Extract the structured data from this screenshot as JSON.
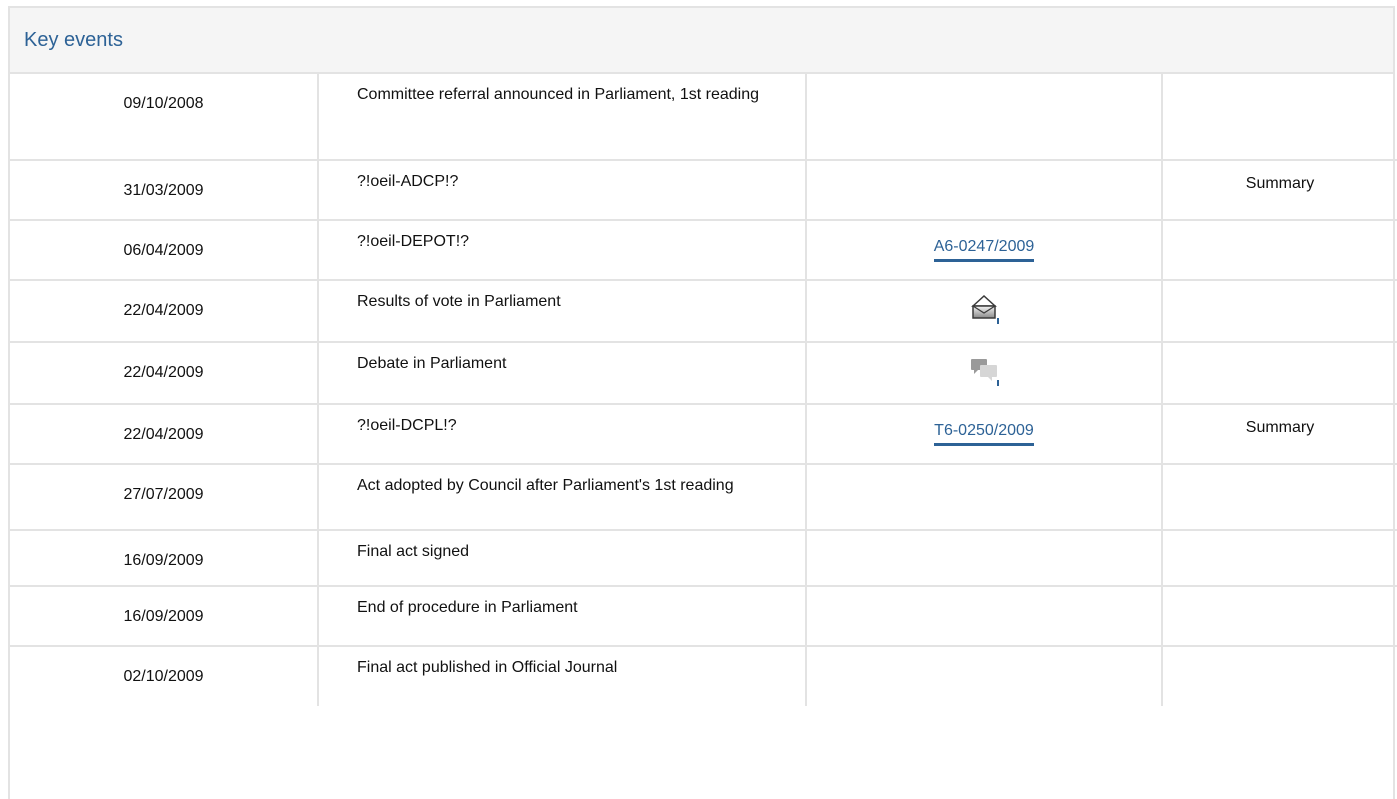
{
  "panel": {
    "title": "Key events"
  },
  "events": [
    {
      "date": "09/10/2008",
      "event": "Committee referral announced in Parliament, 1st reading",
      "doc": "",
      "doc_icon": "",
      "summary": ""
    },
    {
      "date": "31/03/2009",
      "event": "?!oeil-ADCP!?",
      "doc": "",
      "doc_icon": "",
      "summary": "Summary"
    },
    {
      "date": "06/04/2009",
      "event": "?!oeil-DEPOT!?",
      "doc": "A6-0247/2009",
      "doc_icon": "",
      "summary": ""
    },
    {
      "date": "22/04/2009",
      "event": "Results of vote in Parliament",
      "doc": "",
      "doc_icon": "vote-results-icon",
      "summary": ""
    },
    {
      "date": "22/04/2009",
      "event": "Debate in Parliament",
      "doc": "",
      "doc_icon": "debate-icon",
      "summary": ""
    },
    {
      "date": "22/04/2009",
      "event": "?!oeil-DCPL!?",
      "doc": "T6-0250/2009",
      "doc_icon": "",
      "summary": "Summary"
    },
    {
      "date": "27/07/2009",
      "event": "Act adopted by Council after Parliament's 1st reading",
      "doc": "",
      "doc_icon": "",
      "summary": ""
    },
    {
      "date": "16/09/2009",
      "event": "Final act signed",
      "doc": "",
      "doc_icon": "",
      "summary": ""
    },
    {
      "date": "16/09/2009",
      "event": "End of procedure in Parliament",
      "doc": "",
      "doc_icon": "",
      "summary": ""
    },
    {
      "date": "02/10/2009",
      "event": "Final act published in Official Journal",
      "doc": "",
      "doc_icon": "",
      "summary": ""
    }
  ],
  "colors": {
    "link": "#2d6296",
    "border": "#e3e3e3",
    "header_bg": "#f5f5f5"
  }
}
